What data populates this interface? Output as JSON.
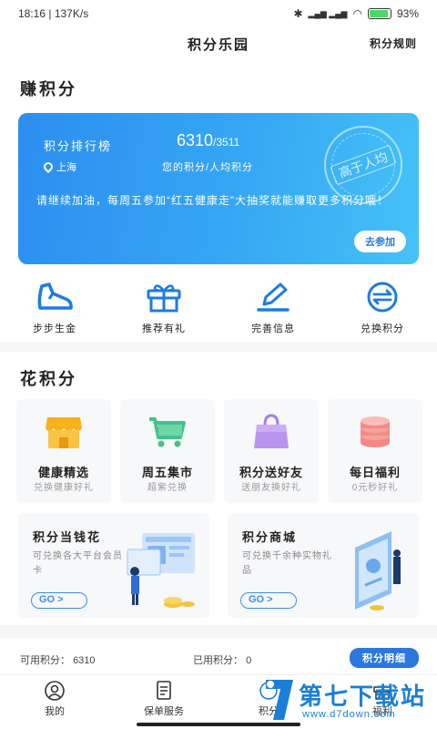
{
  "status": {
    "time": "18:16",
    "speed": "137K/s",
    "network": "HD 4G HD 4G",
    "battery": "93"
  },
  "header": {
    "title": "积分乐园",
    "rules_label": "积分规则"
  },
  "earn": {
    "section_title": "赚积分",
    "banner": {
      "rank_label": "积分排行榜",
      "score": "6310",
      "score_total": "/3511",
      "location": "上海",
      "score_desc": "您的积分/人均积分",
      "message": "请继续加油，每周五参加“红五健康走”大抽奖就能赚取更多积分哦！",
      "join_label": "去参加",
      "stamp_text": "高于人均"
    },
    "quick_actions": [
      {
        "label": "步步生金",
        "icon": "shoe-icon"
      },
      {
        "label": "推荐有礼",
        "icon": "gift-icon"
      },
      {
        "label": "完善信息",
        "icon": "edit-icon"
      },
      {
        "label": "兑换积分",
        "icon": "exchange-icon"
      }
    ]
  },
  "spend": {
    "section_title": "花积分",
    "cards": [
      {
        "title": "健康精选",
        "subtitle": "兑换健康好礼",
        "icon": "shop-icon"
      },
      {
        "title": "周五集市",
        "subtitle": "超紫兑换",
        "icon": "cart-icon"
      },
      {
        "title": "积分送好友",
        "subtitle": "送朋友换好礼",
        "icon": "bag-icon"
      },
      {
        "title": "每日福利",
        "subtitle": "0元秒好礼",
        "icon": "coins-icon"
      }
    ],
    "big_cards": [
      {
        "title": "积分当钱花",
        "subtitle": "可兑换各大平台会员卡",
        "go_label": "GO >"
      },
      {
        "title": "积分商城",
        "subtitle": "可兑换千余种实物礼品",
        "go_label": "GO >"
      }
    ]
  },
  "summary": {
    "available_label": "可用积分：",
    "available_value": "6310",
    "used_label": "已用积分：",
    "used_value": "0",
    "detail_label": "积分明细"
  },
  "tabs": [
    {
      "label": "我的",
      "icon": "person-icon"
    },
    {
      "label": "保单服务",
      "icon": "document-icon"
    },
    {
      "label": "积分",
      "icon": "points-icon"
    },
    {
      "label": "福利",
      "icon": "gift-icon"
    }
  ],
  "watermark": {
    "brand": "第七下载站",
    "url": "www.d7down.com"
  },
  "colors": {
    "accent": "#2a77e0",
    "banner_start": "#2b8ef0",
    "banner_end": "#45c2f6"
  }
}
